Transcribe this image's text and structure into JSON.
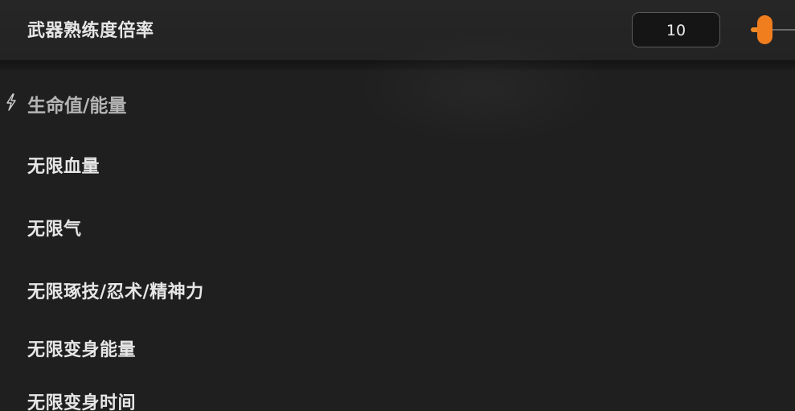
{
  "weapon_multiplier": {
    "label": "武器熟练度倍率",
    "value": "10",
    "slider_level_fraction": 0.05,
    "accent_color": "#f07d1e"
  },
  "section": {
    "icon": "lightning-bolt-icon",
    "title": "生命值/能量"
  },
  "items": [
    {
      "label": "无限血量"
    },
    {
      "label": "无限气"
    },
    {
      "label": "无限琢技/忍术/精神力"
    },
    {
      "label": "无限变身能量"
    },
    {
      "label": "无限变身时间"
    }
  ]
}
